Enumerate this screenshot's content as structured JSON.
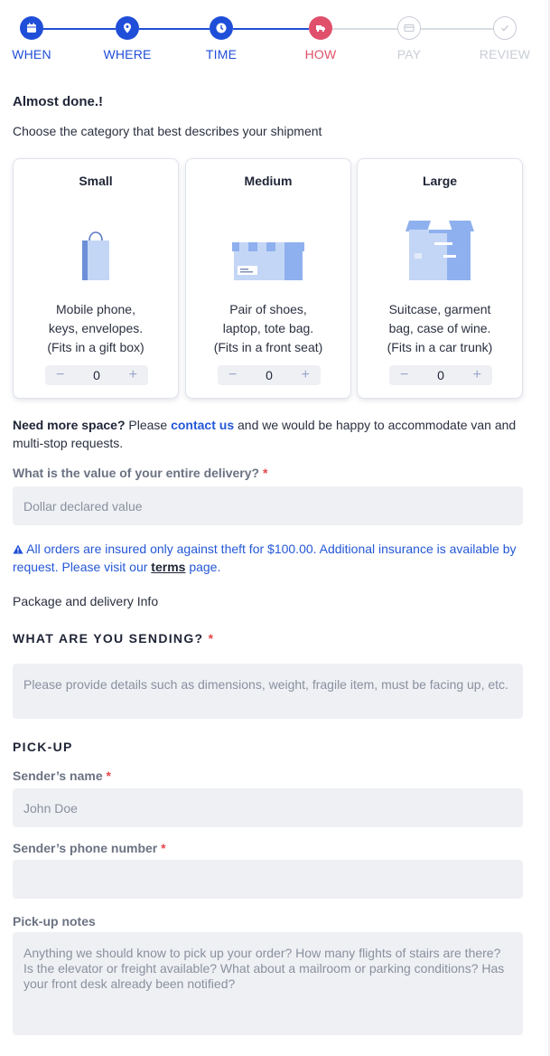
{
  "steps": [
    {
      "label": "WHEN",
      "state": "done",
      "icon": "calendar-icon"
    },
    {
      "label": "WHERE",
      "state": "done",
      "icon": "map-pin-icon"
    },
    {
      "label": "TIME",
      "state": "done",
      "icon": "clock-icon"
    },
    {
      "label": "HOW",
      "state": "active",
      "icon": "truck-icon"
    },
    {
      "label": "PAY",
      "state": "pending",
      "icon": "credit-card-icon"
    },
    {
      "label": "REVIEW",
      "state": "pending",
      "icon": "check-icon"
    }
  ],
  "colors": {
    "done": "#1f4ed8",
    "active": "#e0506b",
    "pending": "#c9cdd6",
    "link": "#2457d6",
    "required": "#e5484d"
  },
  "heading": "Almost done.!",
  "subheading": "Choose the category that best describes your shipment",
  "categories": [
    {
      "title": "Small",
      "desc1": "Mobile phone,",
      "desc2": "keys, envelopes.",
      "desc3": "(Fits in a gift box)",
      "qty": "0",
      "icon": "gift-bag-icon"
    },
    {
      "title": "Medium",
      "desc1": "Pair of shoes,",
      "desc2": "laptop, tote bag.",
      "desc3": "(Fits in a front seat)",
      "qty": "0",
      "icon": "shoe-box-icon"
    },
    {
      "title": "Large",
      "desc1": "Suitcase, garment",
      "desc2": "bag, case of wine.",
      "desc3": "(Fits in a car trunk)",
      "qty": "0",
      "icon": "large-box-icon"
    }
  ],
  "minus": "−",
  "plus": "+",
  "more_space": {
    "bold": "Need more space?",
    "pre": " Please ",
    "link": "contact us",
    "post": " and we would be happy to accommodate van and multi-stop requests."
  },
  "value_field": {
    "label": "What is the value of your entire delivery?",
    "required": "*",
    "placeholder": "Dollar declared value"
  },
  "insurance": {
    "warning_icon": "warning-icon",
    "text": " All orders are insured only against theft for $100.00. Additional insurance is available by request. Please visit our ",
    "link": "terms",
    "post": " page."
  },
  "package_info": "Package and delivery Info",
  "sending": {
    "heading": "WHAT ARE YOU SENDING?",
    "required": "*",
    "placeholder": "Please provide details such as dimensions, weight, fragile item, must be facing up, etc."
  },
  "pickup": {
    "heading": "PICK-UP",
    "name_label": "Sender’s name",
    "name_required": "*",
    "name_placeholder": "John Doe",
    "phone_label": "Sender’s phone number",
    "phone_required": "*",
    "phone_placeholder": "",
    "notes_label": "Pick-up notes",
    "notes_placeholder": "Anything we should know to pick up your order? How many flights of stairs are there? Is the elevator or freight available? What about a mailroom or parking conditions? Has your front desk already been notified?"
  }
}
